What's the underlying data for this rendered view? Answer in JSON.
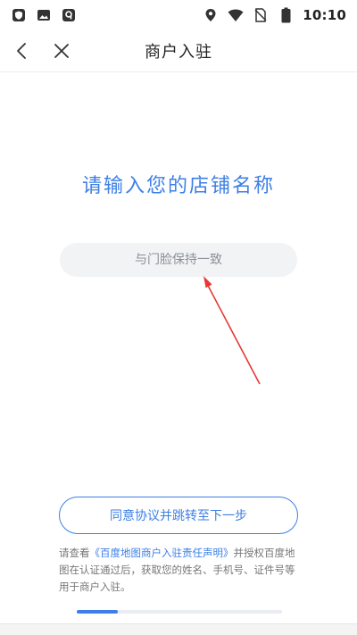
{
  "status_bar": {
    "time": "10:10",
    "left_icons": [
      "shield-icon",
      "image-icon",
      "app-icon"
    ],
    "right_icons": [
      "location-icon",
      "wifi-icon",
      "no-sim-icon",
      "battery-icon"
    ]
  },
  "nav": {
    "title": "商户入驻"
  },
  "main": {
    "heading": "请输入您的店铺名称",
    "input_placeholder": "与门脸保持一致",
    "input_value": ""
  },
  "footer": {
    "agree_button_label": "同意协议并跳转至下一步",
    "notice_prefix": "请查看",
    "notice_link": "《百度地图商户入驻责任声明》",
    "notice_suffix": "并授权百度地图在认证通过后，获取您的姓名、手机号、证件号等用于商户入驻。"
  },
  "progress": {
    "fraction": 0.2
  },
  "colors": {
    "accent": "#3d7fe6",
    "annotation_arrow": "#e53935"
  }
}
